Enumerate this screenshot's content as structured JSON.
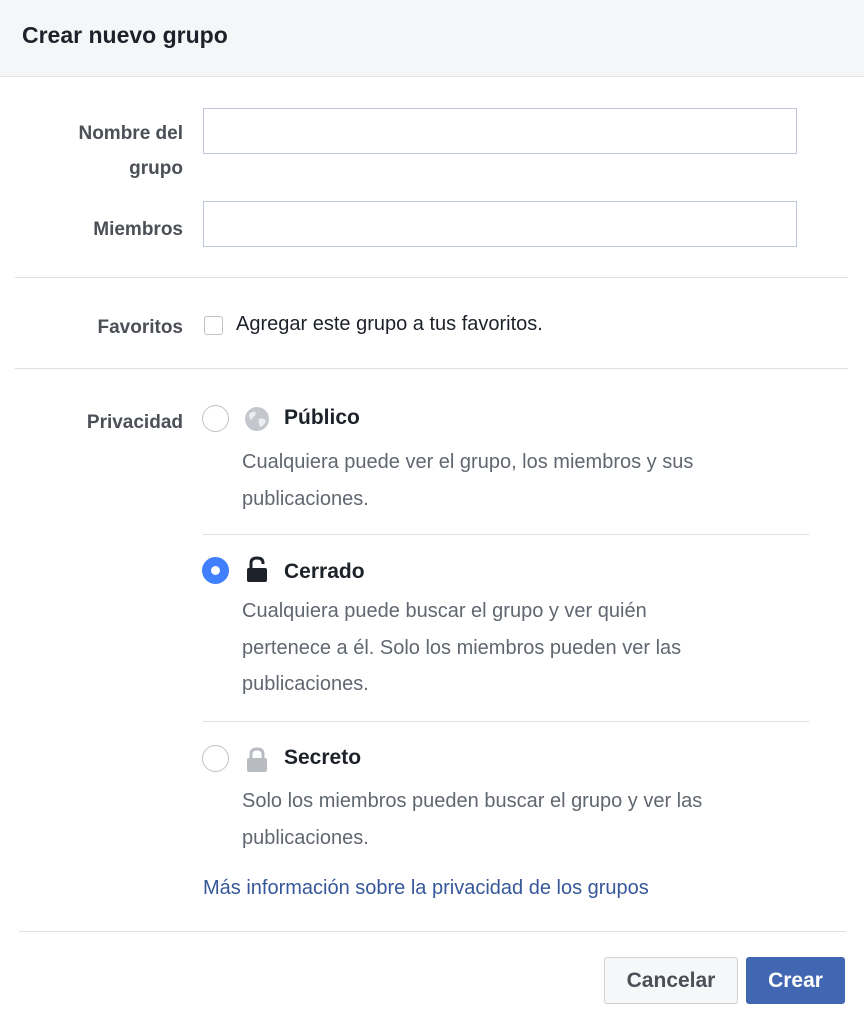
{
  "dialog": {
    "title": "Crear nuevo grupo"
  },
  "form": {
    "name_label_line1": "Nombre del",
    "name_label_line2": "grupo",
    "name_value": "",
    "members_label": "Miembros",
    "members_value": "",
    "favorites_label": "Favoritos",
    "favorites_checkbox_label": "Agregar este grupo a tus favoritos.",
    "favorites_checked": false,
    "privacy_label": "Privacidad"
  },
  "privacy_options": [
    {
      "title": "Público",
      "icon": "globe-icon",
      "selected": false,
      "desc_lines": [
        "Cualquiera puede ver el grupo, los miembros y sus",
        "publicaciones."
      ]
    },
    {
      "title": "Cerrado",
      "icon": "lock-open-icon",
      "selected": true,
      "desc_lines": [
        "Cualquiera puede buscar el grupo y ver quién",
        "pertenece a él. Solo los miembros pueden ver las",
        "publicaciones."
      ]
    },
    {
      "title": "Secreto",
      "icon": "lock-icon",
      "selected": false,
      "desc_lines": [
        "Solo los miembros pueden buscar el grupo y ver las",
        "publicaciones."
      ]
    }
  ],
  "links": {
    "privacy_info": "Más información sobre la privacidad de los grupos"
  },
  "buttons": {
    "cancel": "Cancelar",
    "create": "Crear"
  },
  "colors": {
    "accent": "#4267b2",
    "radio_selected": "#4080ff",
    "link": "#365899",
    "header_bg": "#f5f6f7"
  }
}
